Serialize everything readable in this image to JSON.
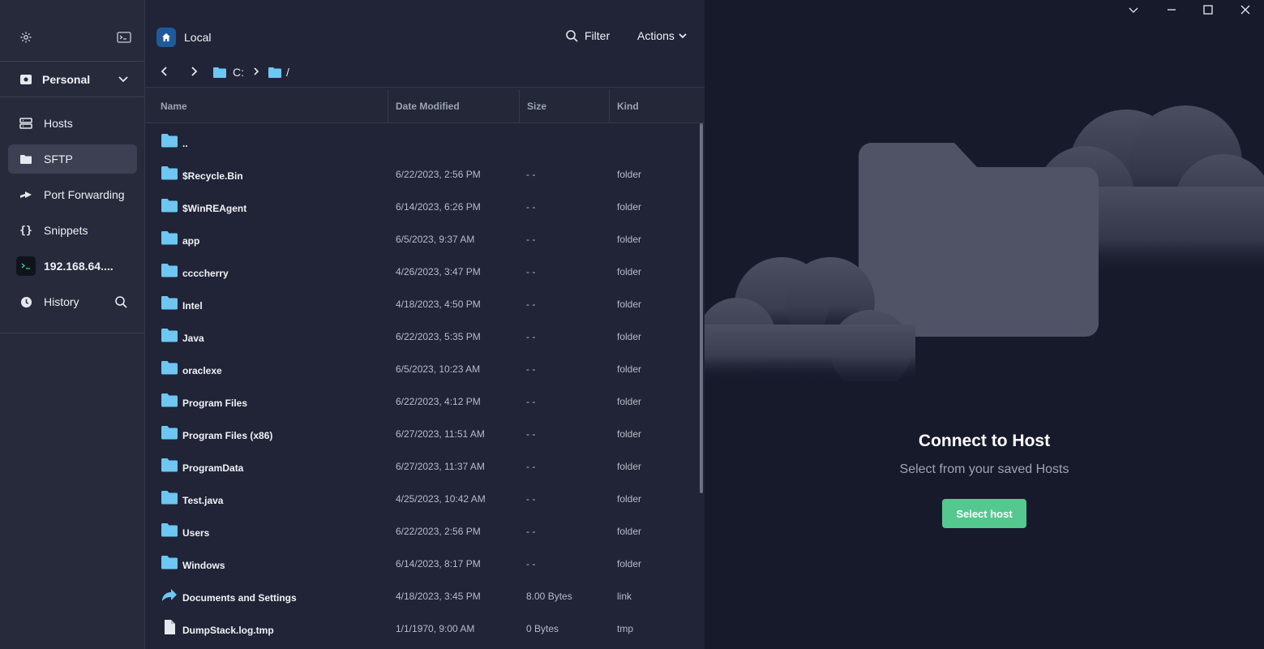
{
  "sidebar": {
    "vault_label": "Personal",
    "items": [
      {
        "label": "Hosts",
        "icon": "hosts-icon"
      },
      {
        "label": "SFTP",
        "icon": "folder-icon",
        "active": true
      },
      {
        "label": "Port Forwarding",
        "icon": "port-forwarding-icon"
      },
      {
        "label": "Snippets",
        "icon": "braces-icon"
      },
      {
        "label": "192.168.64....",
        "icon": "terminal-icon"
      },
      {
        "label": "History",
        "icon": "clock-icon"
      }
    ]
  },
  "panel": {
    "title": "Local",
    "filter_label": "Filter",
    "actions_label": "Actions",
    "breadcrumb": {
      "drive": "C:",
      "path": "/"
    },
    "columns": {
      "name": "Name",
      "date": "Date Modified",
      "size": "Size",
      "kind": "Kind"
    },
    "rows": [
      {
        "name": "..",
        "date": "",
        "size": "",
        "kind": "",
        "icon": "folder-icon"
      },
      {
        "name": "$Recycle.Bin",
        "date": "6/22/2023, 2:56 PM",
        "size": "- -",
        "kind": "folder",
        "icon": "folder-icon"
      },
      {
        "name": "$WinREAgent",
        "date": "6/14/2023, 6:26 PM",
        "size": "- -",
        "kind": "folder",
        "icon": "folder-icon"
      },
      {
        "name": "app",
        "date": "6/5/2023, 9:37 AM",
        "size": "- -",
        "kind": "folder",
        "icon": "folder-icon"
      },
      {
        "name": "ccccherry",
        "date": "4/26/2023, 3:47 PM",
        "size": "- -",
        "kind": "folder",
        "icon": "folder-icon"
      },
      {
        "name": "Intel",
        "date": "4/18/2023, 4:50 PM",
        "size": "- -",
        "kind": "folder",
        "icon": "folder-icon"
      },
      {
        "name": "Java",
        "date": "6/22/2023, 5:35 PM",
        "size": "- -",
        "kind": "folder",
        "icon": "folder-icon"
      },
      {
        "name": "oraclexe",
        "date": "6/5/2023, 10:23 AM",
        "size": "- -",
        "kind": "folder",
        "icon": "folder-icon"
      },
      {
        "name": "Program Files",
        "date": "6/22/2023, 4:12 PM",
        "size": "- -",
        "kind": "folder",
        "icon": "folder-icon"
      },
      {
        "name": "Program Files (x86)",
        "date": "6/27/2023, 11:51 AM",
        "size": "- -",
        "kind": "folder",
        "icon": "folder-icon"
      },
      {
        "name": "ProgramData",
        "date": "6/27/2023, 11:37 AM",
        "size": "- -",
        "kind": "folder",
        "icon": "folder-icon"
      },
      {
        "name": "Test.java",
        "date": "4/25/2023, 10:42 AM",
        "size": "- -",
        "kind": "folder",
        "icon": "folder-icon"
      },
      {
        "name": "Users",
        "date": "6/22/2023, 2:56 PM",
        "size": "- -",
        "kind": "folder",
        "icon": "folder-icon"
      },
      {
        "name": "Windows",
        "date": "6/14/2023, 8:17 PM",
        "size": "- -",
        "kind": "folder",
        "icon": "folder-icon"
      },
      {
        "name": "Documents and Settings",
        "date": "4/18/2023, 3:45 PM",
        "size": "8.00 Bytes",
        "kind": "link",
        "icon": "link-arrow-icon"
      },
      {
        "name": "DumpStack.log.tmp",
        "date": "1/1/1970, 9:00 AM",
        "size": "0 Bytes",
        "kind": "tmp",
        "icon": "file-icon"
      }
    ]
  },
  "connect": {
    "title": "Connect to Host",
    "subtitle": "Select from your saved Hosts",
    "button_label": "Select host"
  },
  "colors": {
    "accent_green": "#54c88e",
    "folder_blue": "#6ec6f2",
    "home_badge": "#1f5b9a"
  }
}
